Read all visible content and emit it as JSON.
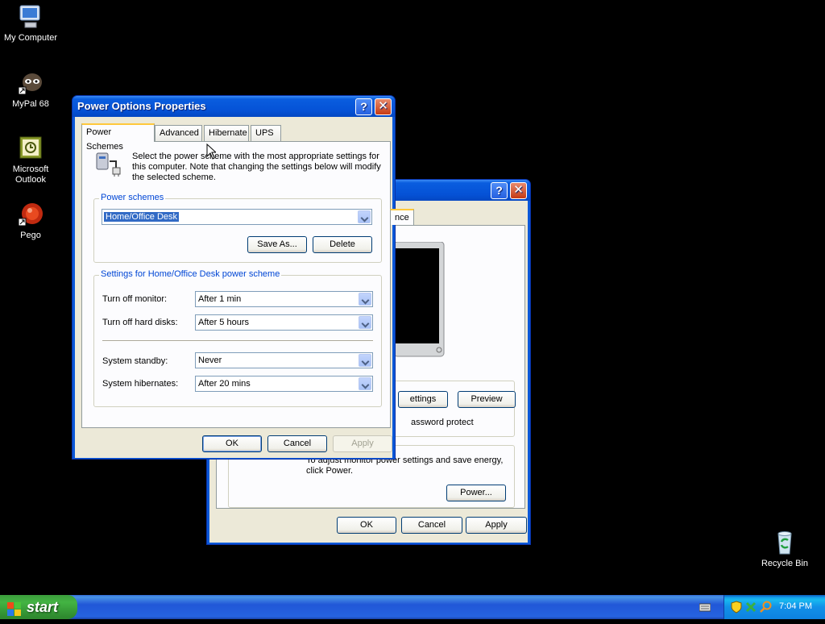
{
  "desktop": {
    "icons": [
      {
        "label": "My Computer"
      },
      {
        "label": "MyPal 68"
      },
      {
        "label": "Microsoft Outlook"
      },
      {
        "label": "Pego"
      },
      {
        "label": "Recycle Bin"
      }
    ]
  },
  "bg_window": {
    "tab_fragment": "nce",
    "settings_fragment": "ettings",
    "preview_label": "Preview",
    "password_fragment": "assword protect",
    "power_text": "To adjust monitor power settings and save energy, click Power.",
    "power_button": "Power...",
    "ok": "OK",
    "cancel": "Cancel",
    "apply": "Apply"
  },
  "dialog": {
    "title": "Power Options Properties",
    "tabs": [
      "Power Schemes",
      "Advanced",
      "Hibernate",
      "UPS"
    ],
    "active_tab": "Power Schemes",
    "description": "Select the power scheme with the most appropriate settings for this computer. Note that changing the settings below will modify the selected scheme.",
    "schemes_group_title": "Power schemes",
    "selected_scheme": "Home/Office Desk",
    "save_as": "Save As...",
    "delete": "Delete",
    "settings_group_title": "Settings for Home/Office Desk power scheme",
    "settings": [
      {
        "label": "Turn off monitor:",
        "value": "After 1 min"
      },
      {
        "label": "Turn off hard disks:",
        "value": "After 5 hours"
      },
      {
        "label": "System standby:",
        "value": "Never"
      },
      {
        "label": "System hibernates:",
        "value": "After 20 mins"
      }
    ],
    "ok": "OK",
    "cancel": "Cancel",
    "apply": "Apply"
  },
  "taskbar": {
    "start_label": "start",
    "clock": "7:04 PM"
  }
}
